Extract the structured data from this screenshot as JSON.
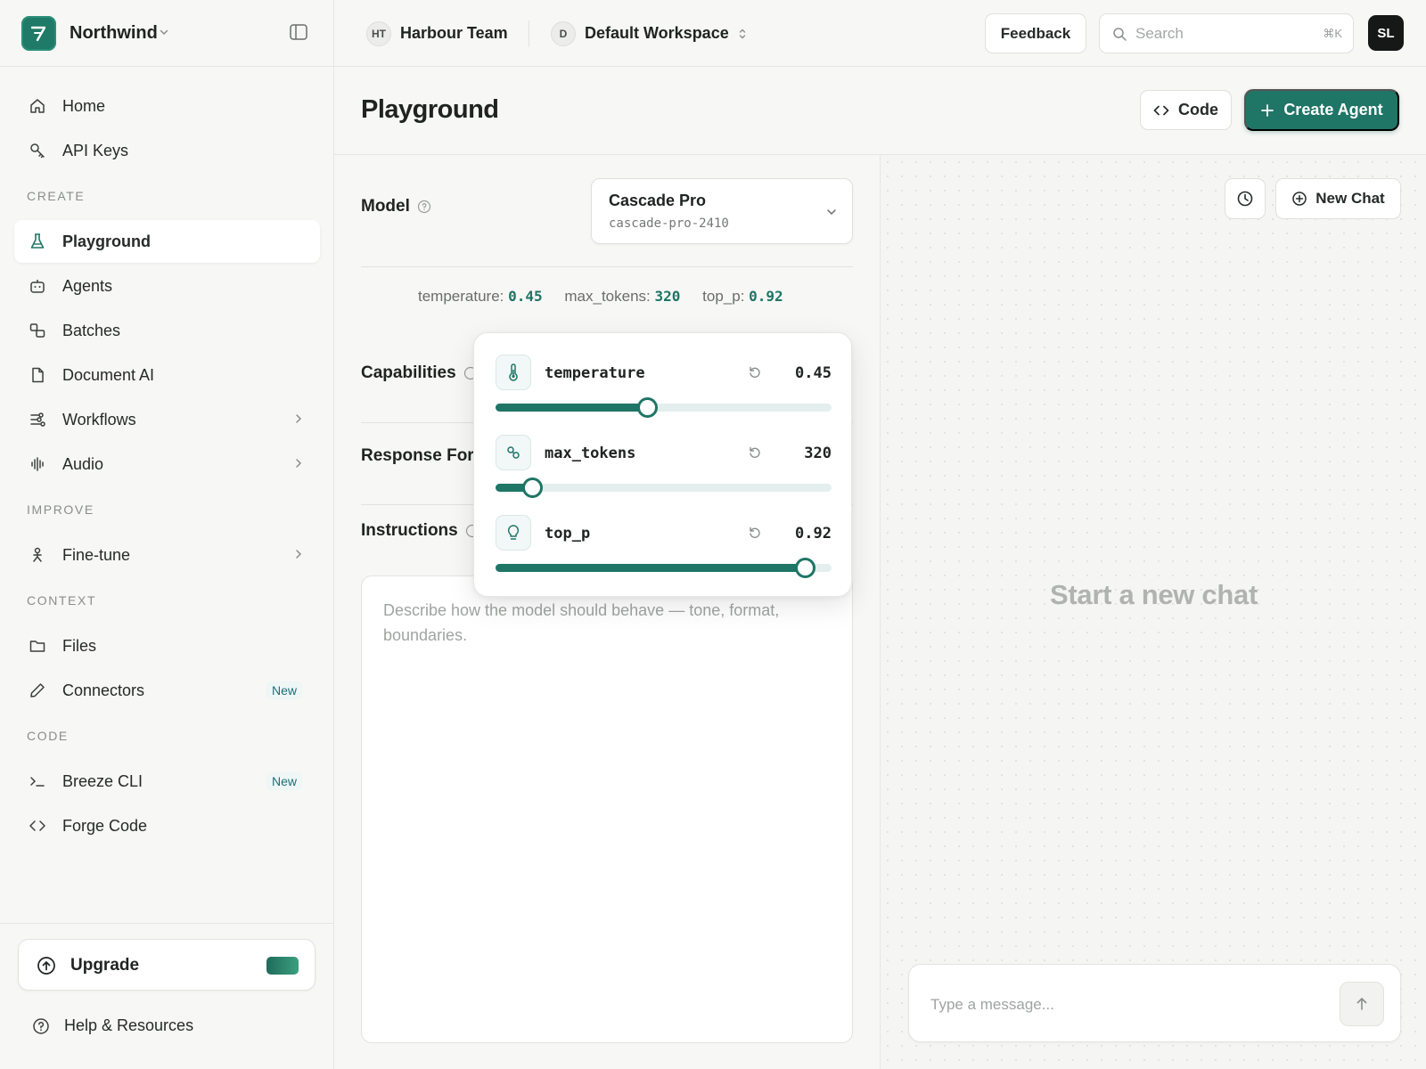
{
  "sidebar": {
    "brand": "Northwind",
    "items_top": [
      {
        "label": "Home",
        "icon": "home-icon"
      },
      {
        "label": "API Keys",
        "icon": "key-icon"
      }
    ],
    "sections": [
      {
        "label": "CREATE",
        "items": [
          {
            "label": "Playground",
            "icon": "flask-icon",
            "active": true
          },
          {
            "label": "Agents",
            "icon": "robot-icon"
          },
          {
            "label": "Batches",
            "icon": "batches-icon"
          },
          {
            "label": "Document AI",
            "icon": "document-icon"
          },
          {
            "label": "Workflows",
            "icon": "workflow-icon",
            "chevron": true
          },
          {
            "label": "Audio",
            "icon": "audio-wave-icon",
            "chevron": true
          }
        ]
      },
      {
        "label": "IMPROVE",
        "items": [
          {
            "label": "Fine-tune",
            "icon": "person-icon",
            "chevron": true
          }
        ]
      },
      {
        "label": "CONTEXT",
        "items": [
          {
            "label": "Files",
            "icon": "folder-icon"
          },
          {
            "label": "Connectors",
            "icon": "pen-icon",
            "badge": "New"
          }
        ]
      },
      {
        "label": "CODE",
        "items": [
          {
            "label": "Breeze CLI",
            "icon": "terminal-icon",
            "badge": "New"
          },
          {
            "label": "Forge Code",
            "icon": "code-icon"
          }
        ]
      }
    ],
    "upgrade_label": "Upgrade",
    "help_label": "Help & Resources"
  },
  "topbar": {
    "team_initials": "HT",
    "team_name": "Harbour Team",
    "workspace_initial": "D",
    "workspace_name": "Default Workspace",
    "feedback_label": "Feedback",
    "search_placeholder": "Search",
    "search_shortcut": "⌘K",
    "user_initials": "SL"
  },
  "header": {
    "title": "Playground",
    "code_label": "Code",
    "create_label": "Create Agent"
  },
  "config": {
    "model_label": "Model",
    "model_name": "Cascade Pro",
    "model_id": "cascade-pro-2410",
    "summary": {
      "temperature_key": "temperature:",
      "temperature_value": "0.45",
      "max_tokens_key": "max_tokens:",
      "max_tokens_value": "320",
      "top_p_key": "top_p:",
      "top_p_value": "0.92"
    },
    "capabilities_label": "Capabilities",
    "response_format_label": "Response Forr",
    "instructions_label": "Instructions",
    "instructions_placeholder": "Describe how the model should behave — tone, format, boundaries."
  },
  "params": [
    {
      "name": "temperature",
      "value": "0.45",
      "icon": "thermometer-icon",
      "fraction": 0.45
    },
    {
      "name": "max_tokens",
      "value": "320",
      "icon": "tokens-icon",
      "fraction": 0.11
    },
    {
      "name": "top_p",
      "value": "0.92",
      "icon": "lightbulb-icon",
      "fraction": 0.92
    }
  ],
  "chat": {
    "new_chat_label": "New Chat",
    "empty_state": "Start a new chat",
    "composer_placeholder": "Type a message..."
  },
  "colors": {
    "accent": "#1f7566",
    "accent_light": "#e4efed",
    "background": "#f7f7f5"
  }
}
